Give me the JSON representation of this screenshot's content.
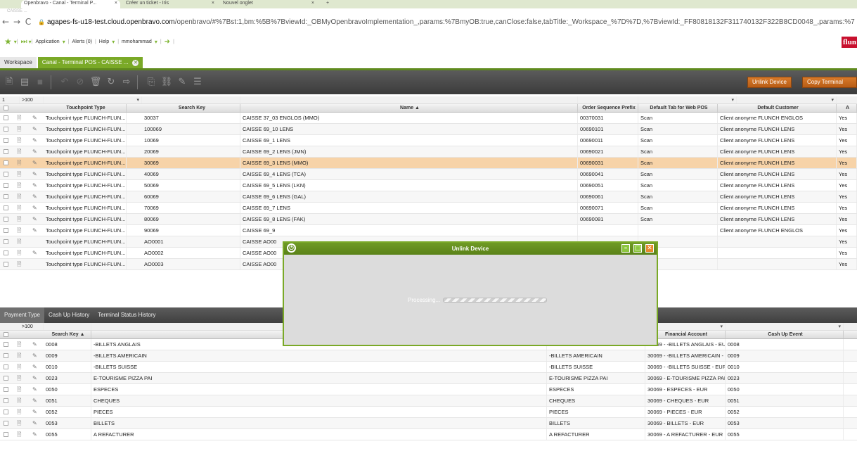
{
  "browser": {
    "tabs": [
      {
        "label": "Openbravo - Canal - Terminal P...",
        "close": "×"
      },
      {
        "label": "Créer un ticket - Iris",
        "close": "×"
      },
      {
        "label": "Nouvel onglet",
        "close": "×"
      }
    ],
    "new_tab": "+",
    "page_mini_title": "CAISSE ...",
    "url_host": "agapes-fs-u18-test.cloud.openbravo.com",
    "url_path": "/openbravo/#%7Bst:1,bm:%5B%7BviewId:_OBMyOpenbravoImplementation_,params:%7BmyOB:true,canClose:false,tabTitle:_Workspace_%7D%7D,%7BviewId:_FF80818132F311740132F322B8CD0048_,params:%7",
    "back": "←",
    "forward": "→",
    "reload": "C",
    "lock": "🔒"
  },
  "app_bar": {
    "items": [
      "Application",
      "Alerts (0)",
      "Help",
      "mmohammad"
    ],
    "brand": "flun"
  },
  "workspace_tabs": [
    {
      "label": "Workspace",
      "active": false
    },
    {
      "label": "Canal - Terminal POS - CAISSE ...",
      "active": true
    }
  ],
  "toolbar": {
    "unlink_label": "Unlink Device",
    "copy_label": "Copy Terminal",
    "icons": [
      "new-doc",
      "grid",
      "save",
      "undo",
      "cancel",
      "delete",
      "refresh",
      "export",
      "attach",
      "link",
      "report",
      "list"
    ]
  },
  "top_grid": {
    "filter_row": {
      "page": "1",
      "count": ">100"
    },
    "headers": [
      "Touchpoint Type",
      "Search Key",
      "Name ▲",
      "Order Sequence Prefix",
      "Default Tab for Web POS",
      "Default Customer",
      "A"
    ],
    "rows": [
      [
        "Touchpoint type FLUNCH-FLUN...",
        "30037",
        "CAISSE 37_03 ENGLOS (MMO)",
        "00370031",
        "Scan",
        "Client anonyme FLUNCH ENGLOS",
        "Yes"
      ],
      [
        "Touchpoint type FLUNCH-FLUN...",
        "100069",
        "CAISSE 69_10 LENS",
        "00690101",
        "Scan",
        "Client anonyme FLUNCH LENS",
        "Yes"
      ],
      [
        "Touchpoint type FLUNCH-FLUN...",
        "10069",
        "CAISSE 69_1 LENS",
        "00690011",
        "Scan",
        "Client anonyme FLUNCH LENS",
        "Yes"
      ],
      [
        "Touchpoint type FLUNCH-FLUN...",
        "20069",
        "CAISSE 69_2 LENS (JMN)",
        "00690021",
        "Scan",
        "Client anonyme FLUNCH LENS",
        "Yes"
      ],
      [
        "Touchpoint type FLUNCH-FLUN...",
        "30069",
        "CAISSE 69_3 LENS (MMO)",
        "00690031",
        "Scan",
        "Client anonyme FLUNCH LENS",
        "Yes"
      ],
      [
        "Touchpoint type FLUNCH-FLUN...",
        "40069",
        "CAISSE 69_4 LENS (TCA)",
        "00690041",
        "Scan",
        "Client anonyme FLUNCH LENS",
        "Yes"
      ],
      [
        "Touchpoint type FLUNCH-FLUN...",
        "50069",
        "CAISSE 69_5 LENS (LKN)",
        "00690051",
        "Scan",
        "Client anonyme FLUNCH LENS",
        "Yes"
      ],
      [
        "Touchpoint type FLUNCH-FLUN...",
        "60069",
        "CAISSE 69_6 LENS (GAL)",
        "00690061",
        "Scan",
        "Client anonyme FLUNCH LENS",
        "Yes"
      ],
      [
        "Touchpoint type FLUNCH-FLUN...",
        "70069",
        "CAISSE 69_7 LENS",
        "00690071",
        "Scan",
        "Client anonyme FLUNCH LENS",
        "Yes"
      ],
      [
        "Touchpoint type FLUNCH-FLUN...",
        "80069",
        "CAISSE 69_8 LENS (FAK)",
        "00690081",
        "Scan",
        "Client anonyme FLUNCH LENS",
        "Yes"
      ],
      [
        "Touchpoint type FLUNCH-FLUN...",
        "90069",
        "CAISSE 69_9",
        "",
        "",
        "Client anonyme FLUNCH ENGLOS",
        "Yes"
      ],
      [
        "Touchpoint type FLUNCH-FLUN...",
        "AO0001",
        "CAISSE AO00",
        "",
        "",
        "",
        "Yes"
      ],
      [
        "Touchpoint type FLUNCH-FLUN...",
        "AO0002",
        "CAISSE AO00",
        "",
        "",
        "",
        "Yes"
      ],
      [
        "Touchpoint type FLUNCH-FLUN...",
        "AO0003",
        "CAISSE AO00",
        "",
        "",
        "",
        "Yes"
      ]
    ]
  },
  "sub_tabs": [
    "Payment Type",
    "Cash Up History",
    "Terminal Status History"
  ],
  "bottom_grid": {
    "filter_row": {
      "count": ">100"
    },
    "headers": [
      "Search Key ▲",
      "",
      "",
      "Financial Account",
      "Cash Up Event"
    ],
    "rows": [
      [
        "0008",
        "-BILLETS ANGLAIS",
        "-BILLETS ANGLAIS",
        "30069 - -BILLETS ANGLAIS - EUR",
        "0008"
      ],
      [
        "0009",
        "-BILLETS AMERICAIN",
        "-BILLETS AMERICAIN",
        "30069 - -BILLETS AMERICAIN - ...",
        "0009"
      ],
      [
        "0010",
        "-BILLETS SUISSE",
        "-BILLETS SUISSE",
        "30069 - -BILLETS SUISSE - EUR",
        "0010"
      ],
      [
        "0023",
        "E-TOURISME PIZZA PAI",
        "E-TOURISME PIZZA PAI",
        "30069 - E-TOURISME PIZZA PAI...",
        "0023"
      ],
      [
        "0050",
        "ESPECES",
        "ESPECES",
        "30069 - ESPECES - EUR",
        "0050"
      ],
      [
        "0051",
        "CHEQUES",
        "CHEQUES",
        "30069 - CHEQUES - EUR",
        "0051"
      ],
      [
        "0052",
        "PIECES",
        "PIECES",
        "30069 - PIECES - EUR",
        "0052"
      ],
      [
        "0053",
        "BILLETS",
        "BILLETS",
        "30069 - BILLETS - EUR",
        "0053"
      ],
      [
        "0055",
        "A REFACTURER",
        "A REFACTURER",
        "30069 - A REFACTURER - EUR",
        "0055"
      ]
    ]
  },
  "dialog": {
    "title": "Unlink Device",
    "processing": "Processing..."
  },
  "colors": {
    "accent_green": "#7aa927",
    "selected_row": "#f7d3a8",
    "button_orange": "#c86a1f"
  }
}
